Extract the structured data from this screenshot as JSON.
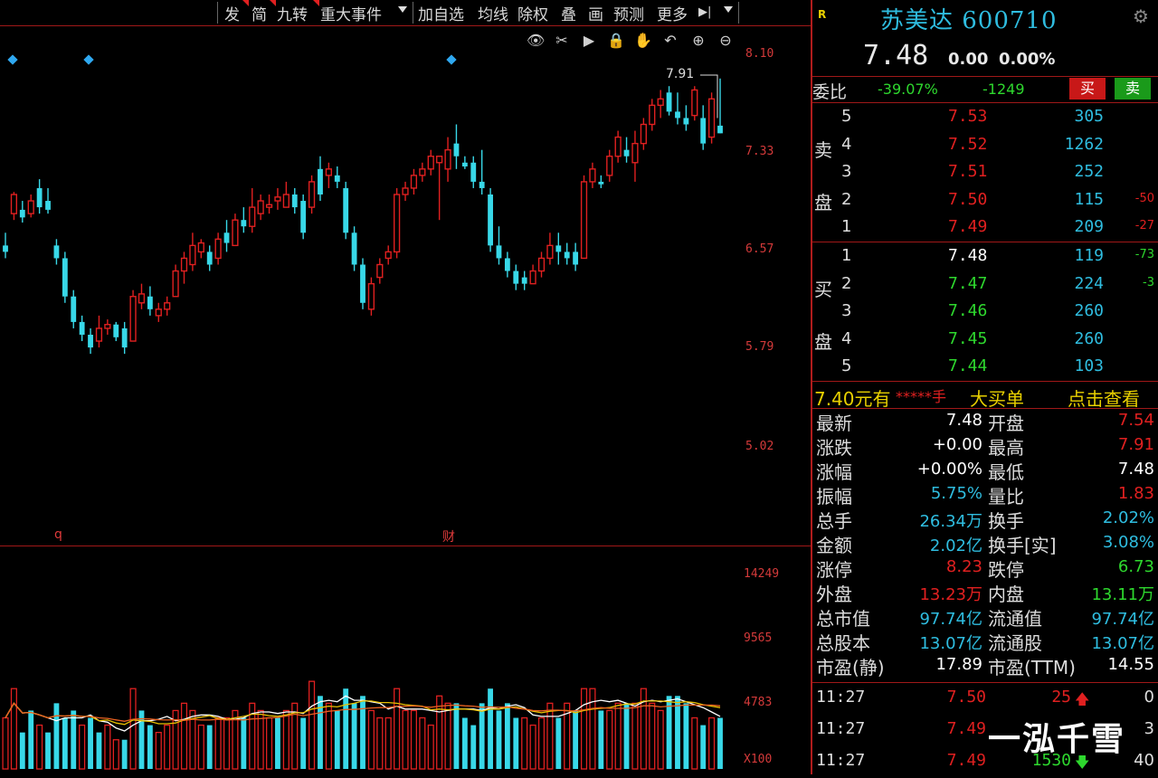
{
  "menu": {
    "items": [
      "发",
      "简",
      "九转",
      "重大事件",
      "加自选",
      "均线",
      "除权",
      "叠",
      "画",
      "预测",
      "更多"
    ]
  },
  "toolbar": {
    "icons": [
      "eye-icon",
      "scissors-icon",
      "play-icon",
      "lock-icon",
      "hand-icon",
      "undo-icon",
      "zoom-in-icon",
      "zoom-out-icon"
    ]
  },
  "chart": {
    "y_labels": [
      "8.10",
      "7.33",
      "6.57",
      "5.79",
      "5.02"
    ],
    "high_annotation": "7.91",
    "event_markers": [
      "q",
      "财"
    ],
    "volume_labels": [
      "14249",
      "9565",
      "4783",
      "X100"
    ],
    "colors": {
      "up": "#e02020",
      "down": "#38d8e8",
      "ma5": "#ffffff",
      "ma10": "#e8c000",
      "ma20": "#e86020"
    }
  },
  "chart_data": {
    "type": "candlestick",
    "candles": [
      [
        6.6,
        6.7,
        6.5,
        6.55
      ],
      [
        6.85,
        7.02,
        6.8,
        7.0
      ],
      [
        6.88,
        6.95,
        6.78,
        6.82
      ],
      [
        6.85,
        7.0,
        6.82,
        6.95
      ],
      [
        7.05,
        7.12,
        6.85,
        6.9
      ],
      [
        6.95,
        7.05,
        6.85,
        6.88
      ],
      [
        6.6,
        6.65,
        6.45,
        6.5
      ],
      [
        6.5,
        6.55,
        6.15,
        6.2
      ],
      [
        6.2,
        6.25,
        5.95,
        6.0
      ],
      [
        6.0,
        6.05,
        5.85,
        5.9
      ],
      [
        5.9,
        5.95,
        5.75,
        5.8
      ],
      [
        5.85,
        6.05,
        5.8,
        5.95
      ],
      [
        5.95,
        6.02,
        5.9,
        5.98
      ],
      [
        5.98,
        6.0,
        5.85,
        5.88
      ],
      [
        5.95,
        6.0,
        5.75,
        5.8
      ],
      [
        5.85,
        6.25,
        5.85,
        6.2
      ],
      [
        6.15,
        6.3,
        6.1,
        6.22
      ],
      [
        6.2,
        6.28,
        6.05,
        6.1
      ],
      [
        6.05,
        6.15,
        6.0,
        6.1
      ],
      [
        6.1,
        6.2,
        6.05,
        6.15
      ],
      [
        6.2,
        6.45,
        6.2,
        6.4
      ],
      [
        6.4,
        6.55,
        6.3,
        6.5
      ],
      [
        6.45,
        6.7,
        6.4,
        6.6
      ],
      [
        6.55,
        6.65,
        6.5,
        6.62
      ],
      [
        6.55,
        6.6,
        6.4,
        6.45
      ],
      [
        6.5,
        6.7,
        6.45,
        6.65
      ],
      [
        6.7,
        6.8,
        6.55,
        6.62
      ],
      [
        6.6,
        6.85,
        6.6,
        6.8
      ],
      [
        6.8,
        6.9,
        6.7,
        6.75
      ],
      [
        6.75,
        7.05,
        6.7,
        6.9
      ],
      [
        6.85,
        7.0,
        6.8,
        6.95
      ],
      [
        6.9,
        7.0,
        6.85,
        6.92
      ],
      [
        6.95,
        7.05,
        6.88,
        6.98
      ],
      [
        6.9,
        7.1,
        6.9,
        7.0
      ],
      [
        7.0,
        7.05,
        6.85,
        6.9
      ],
      [
        6.95,
        7.0,
        6.65,
        6.7
      ],
      [
        6.9,
        7.15,
        6.85,
        7.1
      ],
      [
        7.2,
        7.3,
        6.95,
        7.0
      ],
      [
        7.15,
        7.25,
        7.05,
        7.2
      ],
      [
        7.15,
        7.22,
        7.05,
        7.1
      ],
      [
        7.05,
        7.1,
        6.65,
        6.7
      ],
      [
        6.7,
        6.75,
        6.4,
        6.45
      ],
      [
        6.45,
        6.5,
        6.1,
        6.15
      ],
      [
        6.1,
        6.35,
        6.05,
        6.3
      ],
      [
        6.35,
        6.5,
        6.3,
        6.45
      ],
      [
        6.5,
        6.6,
        6.45,
        6.55
      ],
      [
        6.55,
        7.05,
        6.5,
        7.0
      ],
      [
        7.0,
        7.1,
        6.95,
        7.05
      ],
      [
        7.05,
        7.2,
        7.0,
        7.15
      ],
      [
        7.15,
        7.25,
        7.1,
        7.2
      ],
      [
        7.2,
        7.35,
        7.15,
        7.3
      ],
      [
        7.25,
        7.3,
        6.8,
        7.3
      ],
      [
        7.2,
        7.45,
        7.1,
        7.35
      ],
      [
        7.4,
        7.55,
        7.2,
        7.3
      ],
      [
        7.25,
        7.3,
        7.2,
        7.22
      ],
      [
        7.25,
        7.3,
        7.05,
        7.1
      ],
      [
        7.1,
        7.35,
        7.0,
        7.05
      ],
      [
        7.0,
        7.05,
        6.55,
        6.6
      ],
      [
        6.6,
        6.75,
        6.45,
        6.5
      ],
      [
        6.5,
        6.55,
        6.35,
        6.4
      ],
      [
        6.4,
        6.45,
        6.25,
        6.3
      ],
      [
        6.35,
        6.4,
        6.25,
        6.3
      ],
      [
        6.3,
        6.45,
        6.3,
        6.4
      ],
      [
        6.4,
        6.55,
        6.35,
        6.5
      ],
      [
        6.5,
        6.7,
        6.45,
        6.6
      ],
      [
        6.6,
        6.7,
        6.45,
        6.55
      ],
      [
        6.55,
        6.62,
        6.45,
        6.5
      ],
      [
        6.55,
        6.62,
        6.4,
        6.45
      ],
      [
        6.5,
        7.15,
        6.5,
        7.1
      ],
      [
        7.1,
        7.25,
        7.05,
        7.2
      ],
      [
        7.1,
        7.15,
        7.05,
        7.08
      ],
      [
        7.15,
        7.35,
        7.1,
        7.3
      ],
      [
        7.3,
        7.5,
        7.25,
        7.45
      ],
      [
        7.35,
        7.45,
        7.25,
        7.3
      ],
      [
        7.25,
        7.5,
        7.1,
        7.4
      ],
      [
        7.4,
        7.6,
        7.35,
        7.55
      ],
      [
        7.55,
        7.75,
        7.5,
        7.7
      ],
      [
        7.7,
        7.82,
        7.6,
        7.75
      ],
      [
        7.8,
        7.85,
        7.62,
        7.65
      ],
      [
        7.65,
        7.8,
        7.55,
        7.6
      ],
      [
        7.6,
        7.7,
        7.5,
        7.55
      ],
      [
        7.62,
        7.85,
        7.58,
        7.82
      ],
      [
        7.6,
        7.7,
        7.35,
        7.4
      ],
      [
        7.45,
        7.8,
        7.4,
        7.75
      ],
      [
        7.54,
        7.91,
        7.48,
        7.48
      ]
    ],
    "volumes": [
      3.5,
      5.5,
      2.5,
      4.0,
      3.0,
      2.5,
      4.5,
      3.5,
      4.0,
      3.0,
      3.5,
      2.5,
      3.0,
      2.0,
      2.0,
      5.5,
      4.0,
      3.0,
      2.5,
      3.0,
      4.0,
      4.5,
      4.0,
      3.0,
      3.0,
      3.5,
      3.5,
      4.0,
      3.5,
      4.5,
      4.0,
      3.5,
      3.5,
      4.0,
      4.5,
      3.5,
      6.0,
      5.0,
      4.5,
      4.0,
      5.5,
      4.5,
      5.0,
      4.0,
      3.5,
      3.5,
      5.5,
      4.0,
      4.0,
      3.5,
      3.0,
      5.0,
      4.5,
      4.5,
      3.5,
      3.0,
      4.5,
      5.5,
      4.0,
      4.5,
      3.5,
      3.5,
      3.0,
      3.5,
      4.5,
      3.5,
      4.5,
      4.0,
      5.5,
      5.5,
      4.0,
      4.0,
      4.5,
      4.5,
      4.5,
      5.5,
      4.5,
      4.0,
      5.0,
      5.0,
      4.5,
      3.5,
      3.0,
      3.5,
      3.5
    ],
    "volume_up_flags": [
      1,
      1,
      0,
      0,
      1,
      0,
      0,
      0,
      0,
      1,
      0,
      0,
      1,
      1,
      0,
      1,
      0,
      0,
      1,
      1,
      1,
      1,
      1,
      1,
      0,
      1,
      1,
      1,
      0,
      1,
      1,
      1,
      0,
      1,
      1,
      0,
      1,
      0,
      1,
      0,
      0,
      0,
      0,
      1,
      1,
      1,
      1,
      1,
      1,
      1,
      1,
      1,
      1,
      0,
      0,
      0,
      0,
      0,
      0,
      0,
      0,
      1,
      1,
      1,
      1,
      0,
      1,
      0,
      1,
      1,
      0,
      1,
      1,
      0,
      1,
      1,
      1,
      1,
      0,
      0,
      0,
      1,
      0,
      1,
      0
    ],
    "ylim": [
      5.02,
      8.1
    ],
    "volume_max": 14249
  },
  "stock": {
    "r_tag": "R",
    "name": "苏美达 600710",
    "price": "7.48",
    "change": "0.00",
    "change_pct": "0.00%"
  },
  "weibi": {
    "label": "委比",
    "pct": "-39.07%",
    "diff": "-1249",
    "buy_btn": "买",
    "sell_btn": "卖"
  },
  "orderbook": {
    "sell_label_1": "卖",
    "sell_label_2": "盘",
    "buy_label_1": "买",
    "buy_label_2": "盘",
    "sells": [
      {
        "idx": "5",
        "price": "7.53",
        "vol": "305",
        "chg": ""
      },
      {
        "idx": "4",
        "price": "7.52",
        "vol": "1262",
        "chg": ""
      },
      {
        "idx": "3",
        "price": "7.51",
        "vol": "252",
        "chg": ""
      },
      {
        "idx": "2",
        "price": "7.50",
        "vol": "115",
        "chg": "-50"
      },
      {
        "idx": "1",
        "price": "7.49",
        "vol": "209",
        "chg": "-27"
      }
    ],
    "buys": [
      {
        "idx": "1",
        "price": "7.48",
        "vol": "119",
        "chg": "-73"
      },
      {
        "idx": "2",
        "price": "7.47",
        "vol": "224",
        "chg": "-3"
      },
      {
        "idx": "3",
        "price": "7.46",
        "vol": "260",
        "chg": ""
      },
      {
        "idx": "4",
        "price": "7.45",
        "vol": "260",
        "chg": ""
      },
      {
        "idx": "5",
        "price": "7.44",
        "vol": "103",
        "chg": ""
      }
    ]
  },
  "big_order": {
    "price": "7.40元有",
    "qty": "*****手",
    "label": "大买单",
    "action": "点击查看"
  },
  "quote": [
    {
      "l1": "最新",
      "v1": "7.48",
      "c1": "#ffffff",
      "l2": "开盘",
      "v2": "7.54",
      "c2": "#e02020"
    },
    {
      "l1": "涨跌",
      "v1": "+0.00",
      "c1": "#ffffff",
      "l2": "最高",
      "v2": "7.91",
      "c2": "#e02020"
    },
    {
      "l1": "涨幅",
      "v1": "+0.00%",
      "c1": "#ffffff",
      "l2": "最低",
      "v2": "7.48",
      "c2": "#ffffff"
    },
    {
      "l1": "振幅",
      "v1": "5.75%",
      "c1": "#2fbde0",
      "l2": "量比",
      "v2": "1.83",
      "c2": "#e02020"
    },
    {
      "l1": "总手",
      "v1": "26.34万",
      "c1": "#2fbde0",
      "l2": "换手",
      "v2": "2.02%",
      "c2": "#2fbde0"
    },
    {
      "l1": "金额",
      "v1": "2.02亿",
      "c1": "#2fbde0",
      "l2": "换手[实]",
      "v2": "3.08%",
      "c2": "#2fbde0"
    },
    {
      "l1": "涨停",
      "v1": "8.23",
      "c1": "#e02020",
      "l2": "跌停",
      "v2": "6.73",
      "c2": "#2ed82e"
    },
    {
      "l1": "外盘",
      "v1": "13.23万",
      "c1": "#e02020",
      "l2": "内盘",
      "v2": "13.11万",
      "c2": "#2ed82e"
    },
    {
      "l1": "总市值",
      "v1": "97.74亿",
      "c1": "#2fbde0",
      "l2": "流通值",
      "v2": "97.74亿",
      "c2": "#2fbde0"
    },
    {
      "l1": "总股本",
      "v1": "13.07亿",
      "c1": "#2fbde0",
      "l2": "流通股",
      "v2": "13.07亿",
      "c2": "#2fbde0"
    },
    {
      "l1": "市盈(静)",
      "v1": "17.89",
      "c1": "#ffffff",
      "l2": "市盈(TTM)",
      "v2": "14.55",
      "c2": "#ffffff"
    }
  ],
  "ticks": [
    {
      "time": "11:27",
      "price": "7.50",
      "vol": "25",
      "dir": "up",
      "n": "0"
    },
    {
      "time": "11:27",
      "price": "7.49",
      "vol": "",
      "dir": "",
      "n": "3"
    },
    {
      "time": "11:27",
      "price": "7.49",
      "vol": "1530",
      "dir": "down",
      "n": "40"
    }
  ],
  "watermark": "一泓千雪"
}
